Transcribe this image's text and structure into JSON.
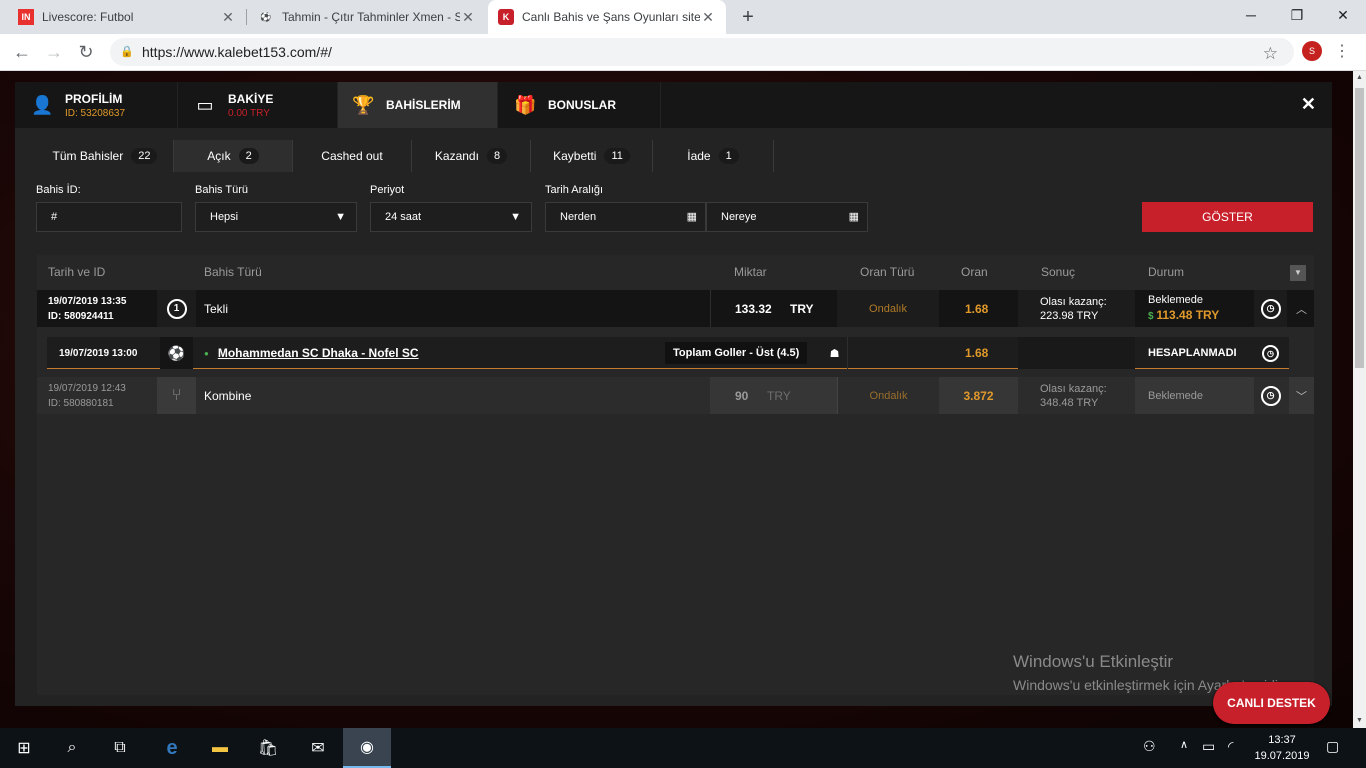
{
  "browser": {
    "tabs": [
      {
        "icon": "IN",
        "title": "Livescore: Futbol"
      },
      {
        "icon": "⚽",
        "title": "Tahmin - Çıtır Tahminler Xmen - S"
      },
      {
        "icon": "K",
        "title": "Canlı Bahis ve Şans Oyunları sitesi"
      }
    ],
    "url": "https://www.kalebet153.com/#/",
    "avatar_letter": "S"
  },
  "nav": {
    "profile": {
      "label": "PROFİLİM",
      "sub": "ID: 53208637"
    },
    "balance": {
      "label": "BAKİYE",
      "sub": "0.00 TRY"
    },
    "bets": {
      "label": "BAHİSLERİM"
    },
    "bonus": {
      "label": "BONUSLAR"
    }
  },
  "filters": [
    {
      "label": "Tüm Bahisler",
      "count": "22"
    },
    {
      "label": "Açık",
      "count": "2"
    },
    {
      "label": "Cashed out",
      "count": ""
    },
    {
      "label": "Kazandı",
      "count": "8"
    },
    {
      "label": "Kaybetti",
      "count": "11"
    },
    {
      "label": "İade",
      "count": "1"
    }
  ],
  "form": {
    "bet_id_label": "Bahis İD:",
    "bet_id_value": "#",
    "bet_type_label": "Bahis Türü",
    "bet_type_value": "Hepsi",
    "period_label": "Periyot",
    "period_value": "24 saat",
    "date_label": "Tarih Aralığı",
    "date_from": "Nerden",
    "date_to": "Nereye",
    "show_button": "GÖSTER"
  },
  "table": {
    "headers": [
      "Tarih ve ID",
      "Bahis Türü",
      "Miktar",
      "Oran Türü",
      "Oran",
      "Sonuç",
      "Durum"
    ],
    "rows": [
      {
        "date": "19/07/2019 13:35",
        "id": "ID: 580924411",
        "type_icon": "1",
        "type": "Tekli",
        "amount": "133.32",
        "currency": "TRY",
        "odds_type": "Ondalık",
        "odds": "1.68",
        "result_label": "Olası kazanç:",
        "result_value": "223.98 TRY",
        "status": "Beklemede",
        "status_value": "113.48 TRY"
      },
      {
        "date": "19/07/2019 12:43",
        "id": "ID: 580880181",
        "type": "Kombine",
        "amount": "90",
        "currency": "TRY",
        "odds_type": "Ondalık",
        "odds": "3.872",
        "result_label": "Olası kazanç:",
        "result_value": "348.48 TRY",
        "status": "Beklemede"
      }
    ],
    "detail": {
      "date": "19/07/2019 13:00",
      "match": "Mohammedan SC Dhaka - Nofel SC",
      "market": "Toplam Goller - Üst (4.5)",
      "odds": "1.68",
      "status": "HESAPLANMADI"
    }
  },
  "watermark": {
    "line1": "Windows'u Etkinleştir",
    "line2": "Windows'u etkinleştirmek için Ayarlar'a gidin."
  },
  "support_button": "CANLI DESTEK",
  "taskbar": {
    "time": "13:37",
    "date": "19.07.2019"
  }
}
